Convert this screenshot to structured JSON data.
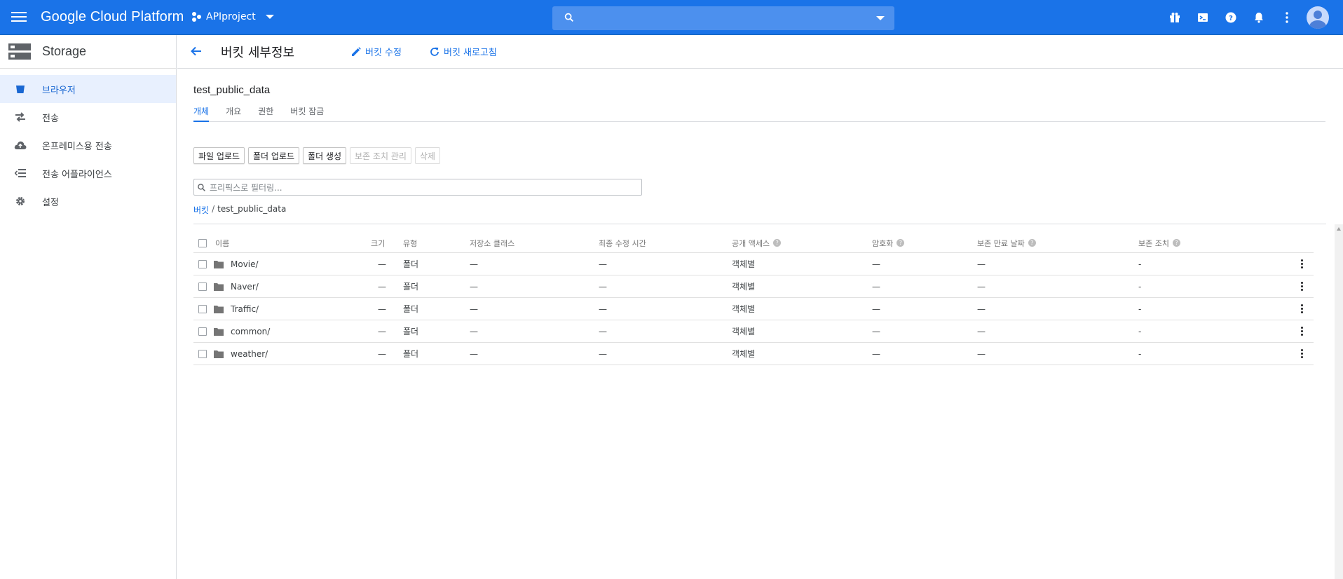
{
  "topbar": {
    "brand": "Google Cloud Platform",
    "project": "APIproject",
    "search_placeholder": "",
    "icons": [
      "gift-icon",
      "cloud-shell-icon",
      "help-icon",
      "notifications-icon",
      "more-vert-icon",
      "account-avatar"
    ]
  },
  "sidebar": {
    "title": "Storage",
    "items": [
      {
        "label": "브라우저",
        "icon": "bucket-icon",
        "active": true
      },
      {
        "label": "전송",
        "icon": "transfer-icon"
      },
      {
        "label": "온프레미스용 전송",
        "icon": "cloud-upload-icon"
      },
      {
        "label": "전송 어플라이언스",
        "icon": "list-icon"
      },
      {
        "label": "설정",
        "icon": "gear-icon"
      }
    ]
  },
  "header": {
    "title": "버킷 세부정보",
    "edit_label": "버킷 수정",
    "refresh_label": "버킷 새로고침"
  },
  "bucket": {
    "name": "test_public_data",
    "tabs": [
      "개체",
      "개요",
      "권한",
      "버킷 잠금"
    ],
    "actions": {
      "upload_files": "파일 업로드",
      "upload_folder": "폴더 업로드",
      "create_folder": "폴더 생성",
      "manage_holds": "보존 조치 관리",
      "delete": "삭제"
    },
    "filter_placeholder": "프리픽스로 필터링...",
    "breadcrumb": {
      "root": "버킷",
      "sep": "/",
      "current": "test_public_data"
    }
  },
  "table": {
    "headers": {
      "name": "이름",
      "size": "크기",
      "type": "유형",
      "storage_class": "저장소 클래스",
      "last_modified": "최종 수정 시간",
      "public_access": "공개 액세스",
      "encryption": "암호화",
      "retention": "보존 만료 날짜",
      "hold": "보존 조치"
    },
    "rows": [
      {
        "name": "Movie/",
        "size": "—",
        "type": "폴더",
        "storage_class": "—",
        "last_modified": "—",
        "public_access": "객체별",
        "encryption": "—",
        "retention": "—",
        "hold": "-"
      },
      {
        "name": "Naver/",
        "size": "—",
        "type": "폴더",
        "storage_class": "—",
        "last_modified": "—",
        "public_access": "객체별",
        "encryption": "—",
        "retention": "—",
        "hold": "-"
      },
      {
        "name": "Traffic/",
        "size": "—",
        "type": "폴더",
        "storage_class": "—",
        "last_modified": "—",
        "public_access": "객체별",
        "encryption": "—",
        "retention": "—",
        "hold": "-"
      },
      {
        "name": "common/",
        "size": "—",
        "type": "폴더",
        "storage_class": "—",
        "last_modified": "—",
        "public_access": "객체별",
        "encryption": "—",
        "retention": "—",
        "hold": "-"
      },
      {
        "name": "weather/",
        "size": "—",
        "type": "폴더",
        "storage_class": "—",
        "last_modified": "—",
        "public_access": "객체별",
        "encryption": "—",
        "retention": "—",
        "hold": "-"
      }
    ]
  },
  "colors": {
    "brand_blue": "#1a73e8",
    "active_bg": "#e8f0fe"
  }
}
